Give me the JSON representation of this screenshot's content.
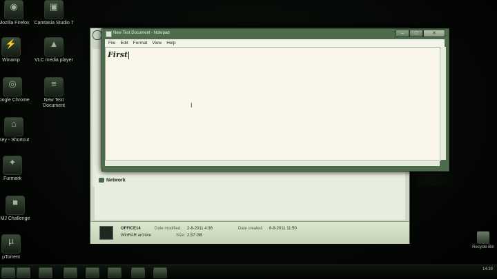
{
  "desktop": {
    "icons": [
      {
        "label": "Mozilla Firefox",
        "glyph": "◉",
        "name": "firefox-icon"
      },
      {
        "label": "Camtasia Studio 7",
        "glyph": "▣",
        "name": "camtasia-icon"
      },
      {
        "label": "Winamp",
        "glyph": "⚡",
        "name": "winamp-icon"
      },
      {
        "label": "VLC media player",
        "glyph": "▲",
        "name": "vlc-icon"
      },
      {
        "label": "Google Chrome",
        "glyph": "◎",
        "name": "chrome-icon"
      },
      {
        "label": "New Text Document",
        "glyph": "≡",
        "name": "text-document-icon"
      },
      {
        "label": "Key - Shortcut",
        "glyph": "⌂",
        "name": "shortcut-icon"
      },
      {
        "label": "Furmark",
        "glyph": "✦",
        "name": "furmark-icon"
      },
      {
        "label": "MJ Challenge",
        "glyph": "■",
        "name": "mj-challenge-icon"
      },
      {
        "label": "µTorrent",
        "glyph": "µ",
        "name": "utorrent-icon"
      }
    ],
    "recycle_bin": "Recycle Bin"
  },
  "explorer": {
    "network_label": "Network",
    "details": {
      "name": "OFFICE14",
      "type": "WinRAR archive",
      "modified_label": "Date modified:",
      "modified_value": "2-8-2011 4:36",
      "size_label": "Size:",
      "size_value": "2,57 GB",
      "created_label": "Date created:",
      "created_value": "6-9-2011 11:50"
    }
  },
  "notepad": {
    "title": "New Text Document - Notepad",
    "menu": [
      "File",
      "Edit",
      "Format",
      "View",
      "Help"
    ],
    "content": "First",
    "window_buttons": {
      "minimize": "–",
      "maximize": "□",
      "close": "✕"
    }
  },
  "taskbar": {
    "clock": "14:39"
  }
}
